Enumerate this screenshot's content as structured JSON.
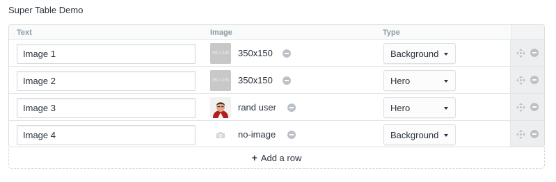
{
  "field": {
    "label": "Super Table Demo"
  },
  "table": {
    "headers": {
      "text": "Text",
      "image": "Image",
      "type": "Type"
    },
    "rows": [
      {
        "text": "Image 1",
        "image": {
          "kind": "placeholder",
          "thumb_label": "350 x 150",
          "name": "350x150"
        },
        "type": "Background"
      },
      {
        "text": "Image 2",
        "image": {
          "kind": "placeholder",
          "thumb_label": "350 x 150",
          "name": "350x150"
        },
        "type": "Hero"
      },
      {
        "text": "Image 3",
        "image": {
          "kind": "user-photo",
          "thumb_label": "",
          "name": "rand user"
        },
        "type": "Hero"
      },
      {
        "text": "Image 4",
        "image": {
          "kind": "no-image",
          "thumb_label": "",
          "name": "no-image"
        },
        "type": "Background"
      }
    ]
  },
  "add_row": {
    "label": "Add a row"
  },
  "colors": {
    "text": "#29323d",
    "muted": "#8f98a3",
    "border": "#dcdee0",
    "action_bg": "#eceef0",
    "icon": "#bcc1c7"
  }
}
